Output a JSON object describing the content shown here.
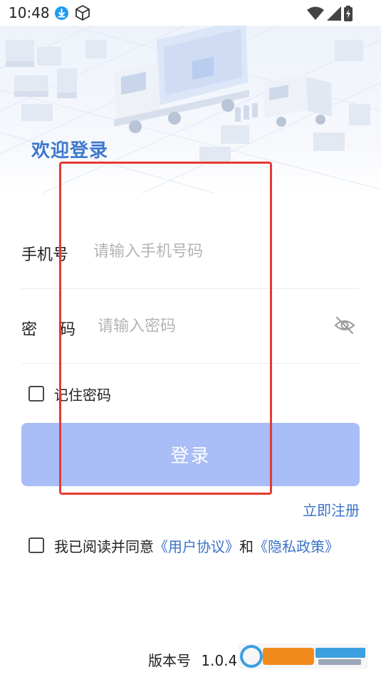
{
  "status_bar": {
    "time": "10:48"
  },
  "hero": {
    "welcome_title": "欢迎登录"
  },
  "form": {
    "phone": {
      "label": "手机号",
      "placeholder": "请输入手机号码",
      "value": ""
    },
    "password": {
      "label_chars": [
        "密",
        "码"
      ],
      "placeholder": "请输入密码",
      "value": ""
    },
    "remember_label": "记住密码",
    "remember_checked": false,
    "login_label": "登录",
    "register_label": "立即注册"
  },
  "agreement": {
    "prefix": "我已阅读并同意",
    "user_agreement": "《用户协议》",
    "and": "和",
    "privacy_policy": "《隐私政策》",
    "checked": false
  },
  "footer": {
    "version_label": "版本号",
    "version_number": "1.0.4"
  },
  "icons": {
    "download": "download-icon",
    "box": "box-icon",
    "wifi": "wifi-icon",
    "signal": "signal-icon",
    "battery": "battery-icon",
    "eye_hidden": "eye-off-icon"
  },
  "colors": {
    "accent": "#3f78cc",
    "link": "#3c72c8",
    "login_button": "#a9bdf7",
    "highlight_box": "#e33b32"
  }
}
